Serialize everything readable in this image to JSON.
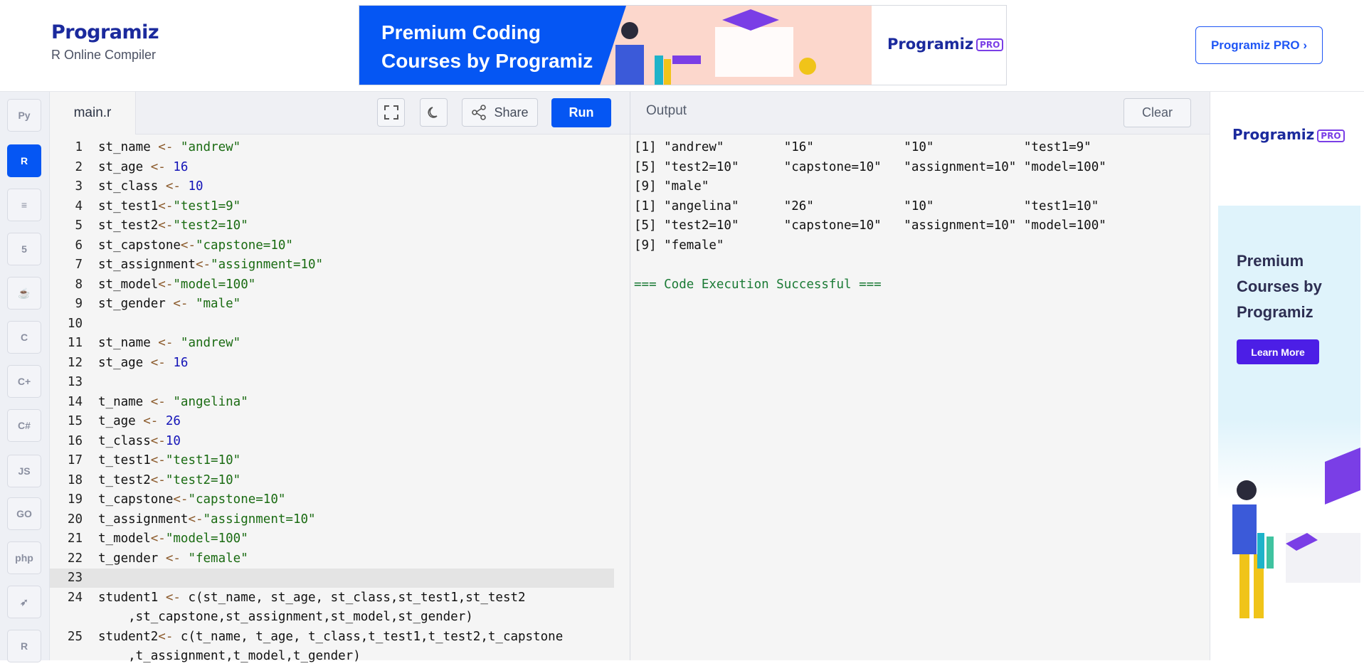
{
  "header": {
    "brand": "Programiz",
    "subtitle": "R Online Compiler",
    "ad_text_line1": "Premium Coding",
    "ad_text_line2": "Courses by Programiz",
    "ad_logo": "Programiz",
    "ad_logo_badge": "PRO",
    "pro_button": "Programiz PRO ›"
  },
  "sidebar": {
    "items": [
      {
        "icon": "python-icon",
        "glyph": "Py"
      },
      {
        "icon": "r-icon",
        "glyph": "R",
        "active": true
      },
      {
        "icon": "database-icon",
        "glyph": "≡"
      },
      {
        "icon": "html5-icon",
        "glyph": "5"
      },
      {
        "icon": "java-icon",
        "glyph": "☕"
      },
      {
        "icon": "c-icon",
        "glyph": "C"
      },
      {
        "icon": "cpp-icon",
        "glyph": "C+"
      },
      {
        "icon": "csharp-icon",
        "glyph": "C#"
      },
      {
        "icon": "javascript-icon",
        "glyph": "JS"
      },
      {
        "icon": "go-icon",
        "glyph": "GO"
      },
      {
        "icon": "php-icon",
        "glyph": "php"
      },
      {
        "icon": "swift-icon",
        "glyph": "➶"
      },
      {
        "icon": "rust-icon",
        "glyph": "R"
      }
    ]
  },
  "editor": {
    "tab": "main.r",
    "share_label": "Share",
    "run_label": "Run",
    "current_line": 23,
    "lines": [
      {
        "n": "1",
        "t": "st_name <- \"andrew\""
      },
      {
        "n": "2",
        "t": "st_age <- 16"
      },
      {
        "n": "3",
        "t": "st_class <- 10"
      },
      {
        "n": "4",
        "t": "st_test1<-\"test1=9\""
      },
      {
        "n": "5",
        "t": "st_test2<-\"test2=10\""
      },
      {
        "n": "6",
        "t": "st_capstone<-\"capstone=10\""
      },
      {
        "n": "7",
        "t": "st_assignment<-\"assignment=10\""
      },
      {
        "n": "8",
        "t": "st_model<-\"model=100\""
      },
      {
        "n": "9",
        "t": "st_gender <- \"male\""
      },
      {
        "n": "10",
        "t": ""
      },
      {
        "n": "11",
        "t": "st_name <- \"andrew\""
      },
      {
        "n": "12",
        "t": "st_age <- 16"
      },
      {
        "n": "13",
        "t": ""
      },
      {
        "n": "14",
        "t": "t_name <- \"angelina\""
      },
      {
        "n": "15",
        "t": "t_age <- 26"
      },
      {
        "n": "16",
        "t": "t_class<-10"
      },
      {
        "n": "17",
        "t": "t_test1<-\"test1=10\""
      },
      {
        "n": "18",
        "t": "t_test2<-\"test2=10\""
      },
      {
        "n": "19",
        "t": "t_capstone<-\"capstone=10\""
      },
      {
        "n": "20",
        "t": "t_assignment<-\"assignment=10\""
      },
      {
        "n": "21",
        "t": "t_model<-\"model=100\""
      },
      {
        "n": "22",
        "t": "t_gender <- \"female\""
      },
      {
        "n": "23",
        "t": ""
      },
      {
        "n": "24",
        "t": "student1 <- c(st_name, st_age, st_class,st_test1,st_test2"
      },
      {
        "n": "",
        "t": "    ,st_capstone,st_assignment,st_model,st_gender)"
      },
      {
        "n": "25",
        "t": "student2<- c(t_name, t_age, t_class,t_test1,t_test2,t_capstone"
      },
      {
        "n": "",
        "t": "    ,t_assignment,t_model,t_gender)"
      }
    ]
  },
  "output": {
    "title": "Output",
    "clear_label": "Clear",
    "lines": [
      "[1] \"andrew\"        \"16\"            \"10\"            \"test1=9\"",
      "[5] \"test2=10\"      \"capstone=10\"   \"assignment=10\" \"model=100\"",
      "[9] \"male\"",
      "[1] \"angelina\"      \"26\"            \"10\"            \"test1=10\"",
      "[5] \"test2=10\"      \"capstone=10\"   \"assignment=10\" \"model=100\"",
      "[9] \"female\"",
      ""
    ],
    "success": "=== Code Execution Successful ==="
  },
  "right_ad": {
    "logo": "Programiz",
    "badge": "PRO",
    "title_line1": "Premium",
    "title_line2": "Courses by",
    "title_line3": "Programiz",
    "button": "Learn More"
  }
}
